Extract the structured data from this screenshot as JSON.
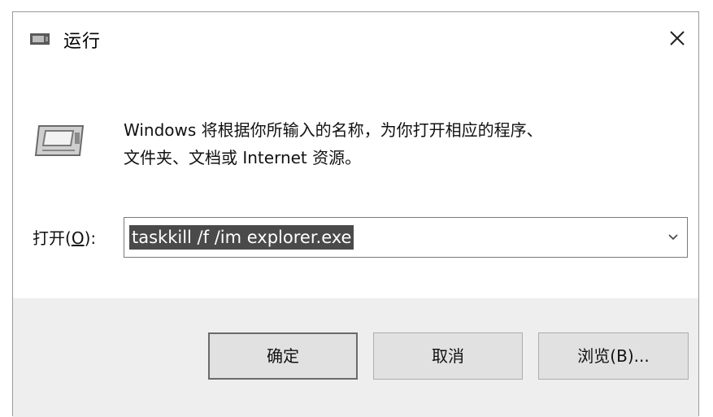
{
  "window": {
    "title": "运行",
    "icon": "run-app-icon",
    "close_icon": "close-icon"
  },
  "content": {
    "description": "Windows 将根据你所输入的名称，为你打开相应的程序、文件夹、文档或 Internet 资源。",
    "description_line1": "Windows 将根据你所输入的名称，为你打开相应的程序、",
    "description_line2": "文件夹、文档或 Internet 资源。",
    "open_label_prefix": "打开(",
    "open_label_accel": "O",
    "open_label_suffix": "):",
    "command_value": "taskkill /f /im explorer.exe",
    "dropdown_icon": "chevron-down-icon"
  },
  "buttons": {
    "ok_label": "确定",
    "cancel_label": "取消",
    "browse_label": "浏览(B)..."
  },
  "colors": {
    "footer_bg": "#eeeeee",
    "selection_bg": "#4a4a4a"
  }
}
